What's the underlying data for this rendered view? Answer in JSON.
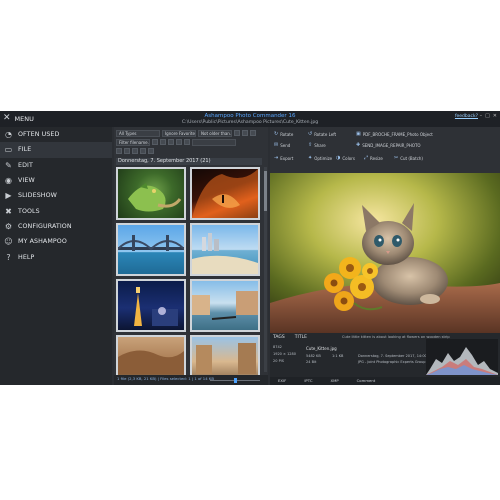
{
  "app": {
    "menu_label": "MENU",
    "title": "Ashampoo Photo Commander 16",
    "path": "C:\\Users\\Public\\Pictures\\Ashampoo Pictures\\Cute_Kitten.jpg",
    "feedback": "feedback?"
  },
  "sidebar": {
    "items": [
      {
        "label": "OFTEN USED",
        "icon": "star-icon"
      },
      {
        "label": "FILE",
        "icon": "file-icon"
      },
      {
        "label": "EDIT",
        "icon": "pencil-icon"
      },
      {
        "label": "VIEW",
        "icon": "eye-icon"
      },
      {
        "label": "SLIDESHOW",
        "icon": "slideshow-icon"
      },
      {
        "label": "TOOLS",
        "icon": "tools-icon"
      },
      {
        "label": "CONFIGURATION",
        "icon": "gear-icon"
      },
      {
        "label": "MY ASHAMPOO",
        "icon": "user-icon"
      },
      {
        "label": "HELP",
        "icon": "question-icon"
      }
    ],
    "active_index": 1
  },
  "browser": {
    "filter_type": "All Types",
    "filter_favorites": "Ignore Favorites",
    "filter_date": "Not older than...",
    "search_placeholder": "Filter filename...",
    "date_header": "Donnerstag, 7. September 2017 (21)",
    "status": "1 file (2,3 KB, 21 KB) | Files selected: 1 | 1 of 14 KB"
  },
  "toolbar": {
    "row1": [
      "Rotate",
      "Rotate Left",
      "PDF_BROCHE_FRAME_Photo Object"
    ],
    "row2": [
      "Send",
      "Share",
      "SEND_IMAGE_REPAIR_PHOTO"
    ],
    "row3": [
      "Export",
      "Optimize",
      "Colors",
      "Resize",
      "Cut (Batch)"
    ]
  },
  "info": {
    "tabs": [
      "TAGS",
      "TITLE"
    ],
    "caption": "Cute little kitten is about looking at flowers on wooden strip",
    "filename": "Cute_Kitten.jpg",
    "meta_left": [
      "8742",
      "1920 × 1280",
      "20 PIS"
    ],
    "meta_mid": [
      "5482 KB",
      "24 Bit",
      "1:1 KB"
    ],
    "meta_right": [
      "Donnerstag, 7. September 2017, 14:00:00",
      "JPG - Joint Photographic Experts Group"
    ],
    "footer": [
      "EXIF",
      "IPTC",
      "XMP",
      "Comment"
    ]
  },
  "colors": {
    "accent": "#4da3ff",
    "app_bg": "#2b2e33",
    "sidebar_bg": "#25282c"
  }
}
